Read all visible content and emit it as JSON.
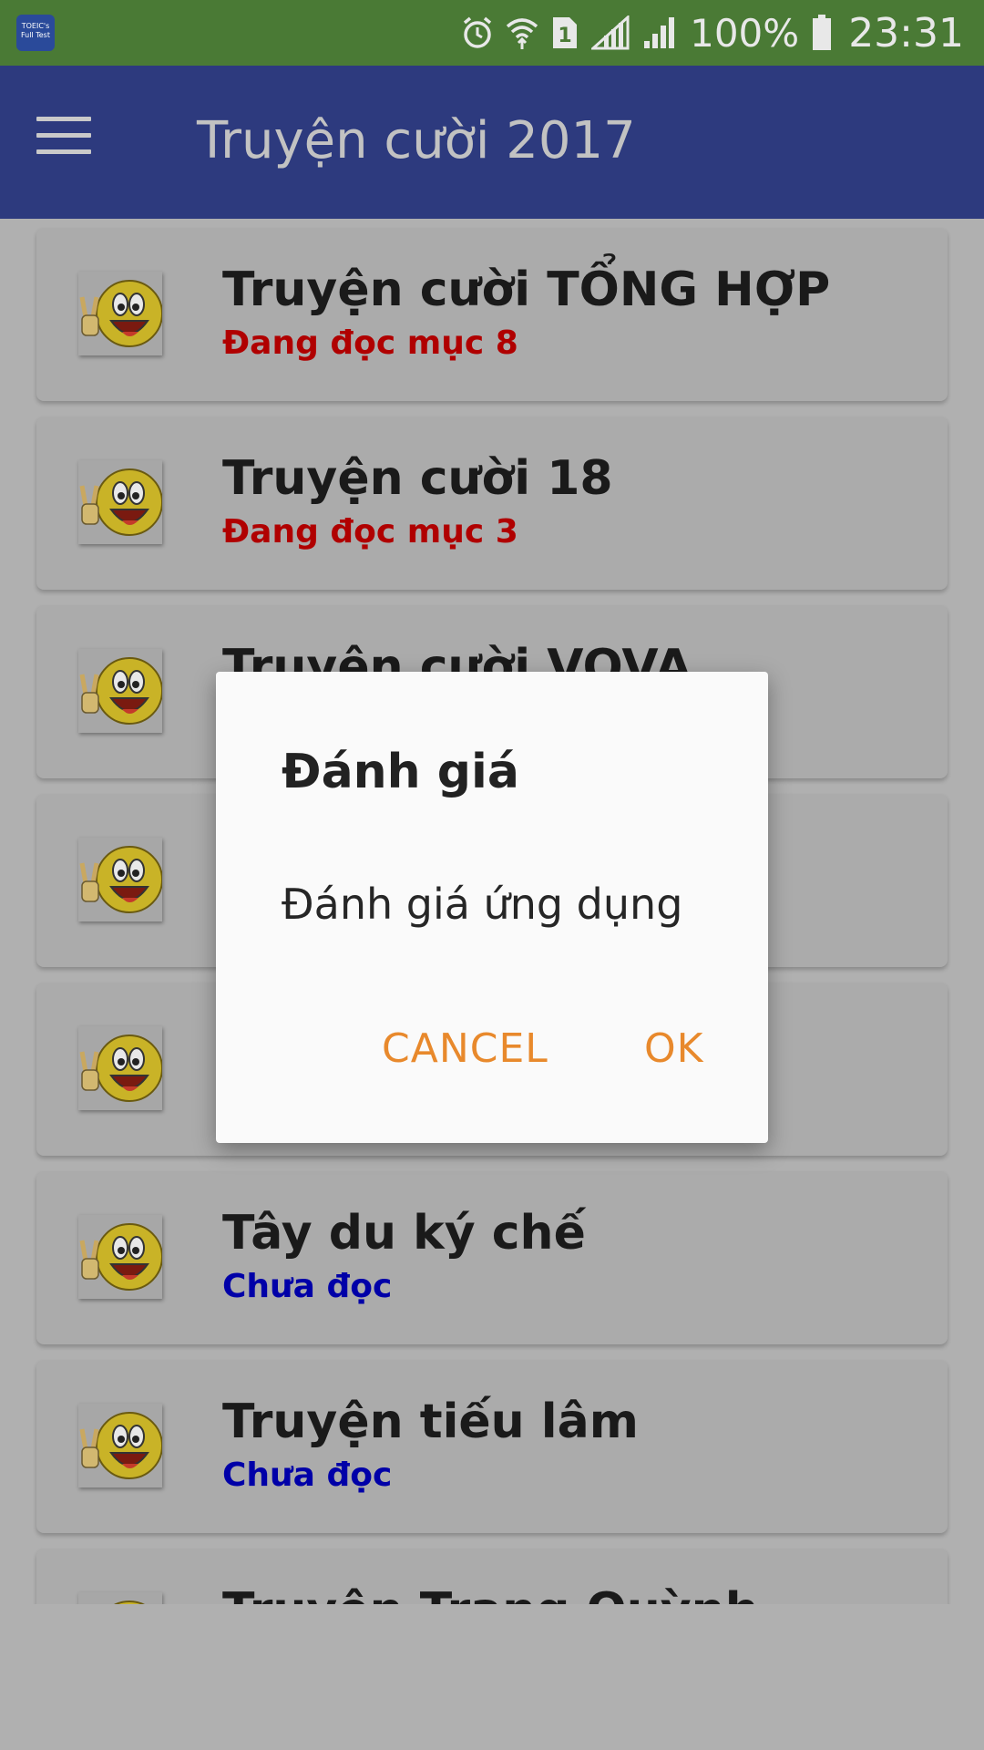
{
  "status_bar": {
    "app_icon_text": "TOEIC's Full Test",
    "battery": "100%",
    "time": "23:31",
    "icons": [
      "alarm-icon",
      "wifi-icon",
      "sim-1-icon",
      "signal-icon",
      "signal-icon",
      "battery-icon"
    ]
  },
  "appbar": {
    "title": "Truyện cười 2017",
    "menu_icon": "hamburger-menu-icon"
  },
  "list": {
    "items": [
      {
        "title": "Truyện cười TỔNG HỢP",
        "status": "Đang đọc mục 8",
        "status_color": "#b00000"
      },
      {
        "title": "Truyện cười 18",
        "status": "Đang đọc mục 3",
        "status_color": "#b00000"
      },
      {
        "title": "Truyện cười VOVA",
        "status": "",
        "status_color": ""
      },
      {
        "title": "",
        "status": "",
        "status_color": ""
      },
      {
        "title": "",
        "status": "",
        "status_color": ""
      },
      {
        "title": "Tây du ký chế",
        "status": "Chưa đọc",
        "status_color": "#0000a8"
      },
      {
        "title": "Truyện tiếu lâm",
        "status": "Chưa đọc",
        "status_color": "#0000a8"
      },
      {
        "title": "Truyện Trạng Quỳnh",
        "status": "",
        "status_color": ""
      }
    ]
  },
  "dialog": {
    "title": "Đánh giá",
    "message": "Đánh giá ứng dụng",
    "cancel_label": "CANCEL",
    "ok_label": "OK"
  },
  "colors": {
    "status_bar": "#4a7a35",
    "app_bar": "#2d3a7e",
    "accent_button": "#e8892c"
  }
}
